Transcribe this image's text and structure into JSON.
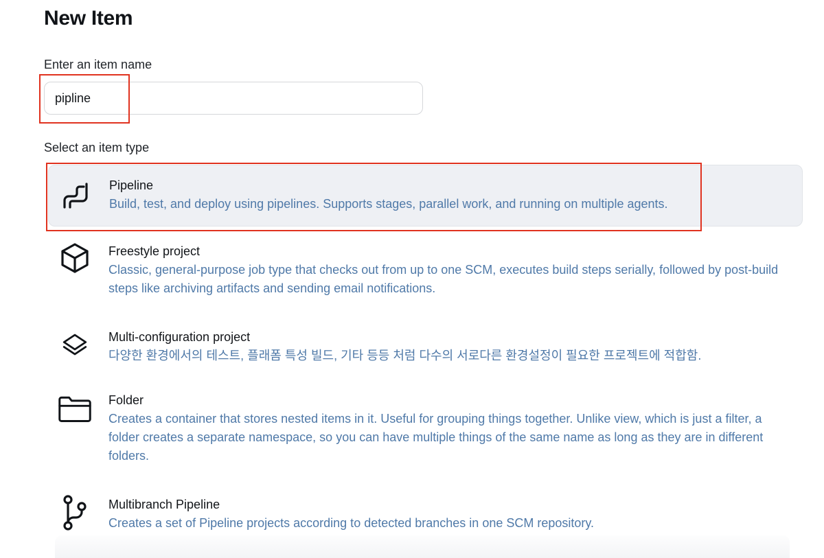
{
  "page": {
    "title": "New Item"
  },
  "name_field": {
    "label": "Enter an item name",
    "value": "pipline"
  },
  "item_types": {
    "label": "Select an item type",
    "items": [
      {
        "name": "Pipeline",
        "description": "Build, test, and deploy using pipelines. Supports stages, parallel work, and running on multiple agents.",
        "icon": "pipeline-icon",
        "selected": true
      },
      {
        "name": "Freestyle project",
        "description": "Classic, general-purpose job type that checks out from up to one SCM, executes build steps serially, followed by post-build steps like archiving artifacts and sending email notifications.",
        "icon": "cube-icon",
        "selected": false
      },
      {
        "name": "Multi-configuration project",
        "description": "다양한 환경에서의 테스트, 플래폼 특성 빌드, 기타 등등 처럼 다수의 서로다른 환경설정이 필요한 프로젝트에 적합함.",
        "icon": "layers-icon",
        "selected": false
      },
      {
        "name": "Folder",
        "description": "Creates a container that stores nested items in it. Useful for grouping things together. Unlike view, which is just a filter, a folder creates a separate namespace, so you can have multiple things of the same name as long as they are in different folders.",
        "icon": "folder-icon",
        "selected": false
      },
      {
        "name": "Multibranch Pipeline",
        "description": "Creates a set of Pipeline projects according to detected branches in one SCM repository.",
        "icon": "branch-icon",
        "selected": false
      }
    ]
  },
  "colors": {
    "highlight": "#e0321f",
    "description_text": "#4f79a8",
    "selected_background": "#eef0f4"
  }
}
